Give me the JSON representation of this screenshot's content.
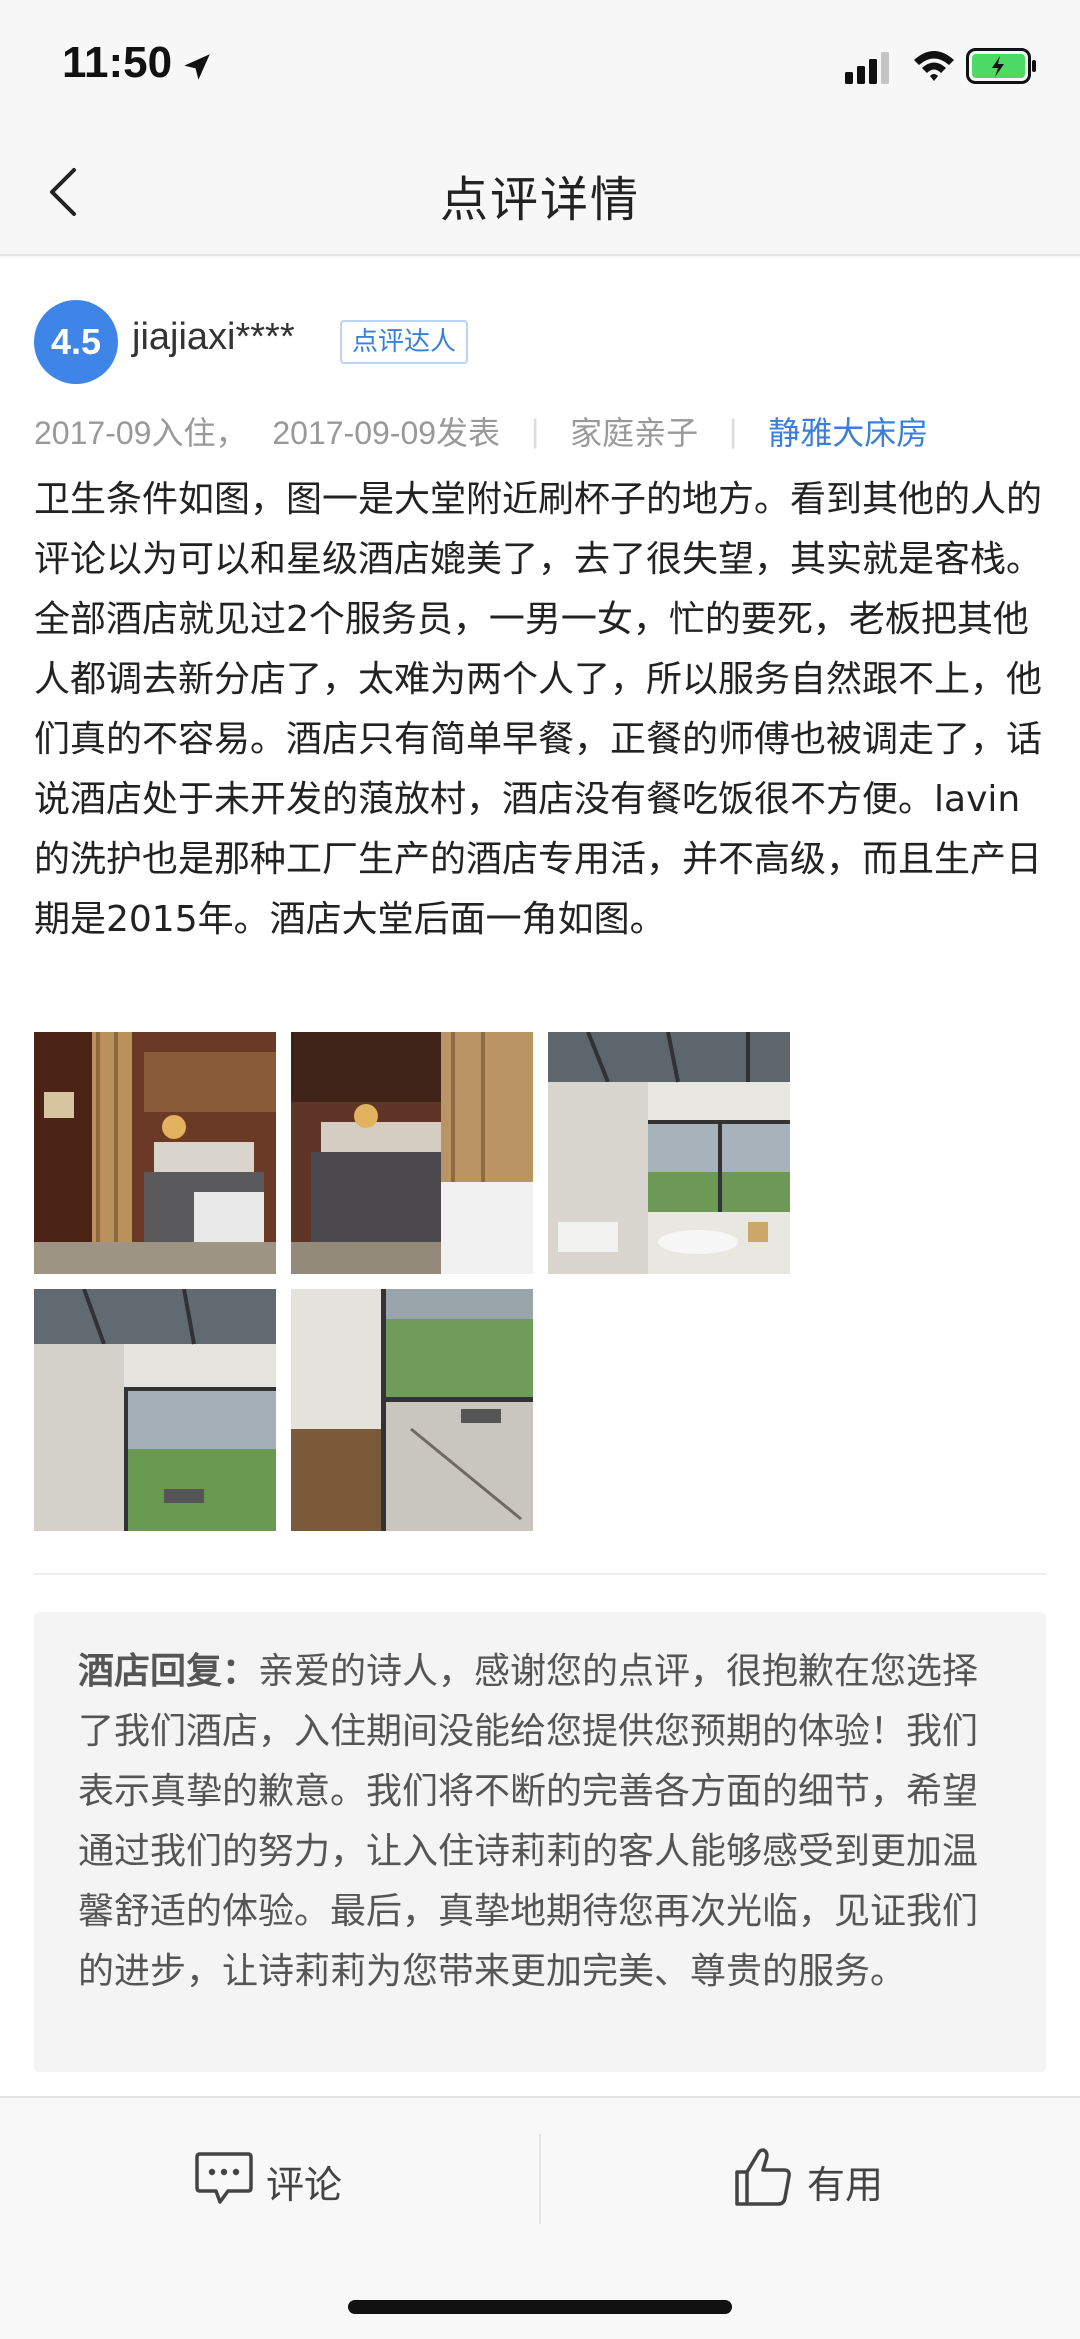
{
  "status": {
    "time": "11:50"
  },
  "nav": {
    "title": "点评详情"
  },
  "review": {
    "score": "4.5",
    "username": "jiajiaxi****",
    "badge": "点评达人",
    "checkin": "2017-09入住，",
    "published": "2017-09-09发表",
    "trip_type": "家庭亲子",
    "room_type": "静雅大床房",
    "text": "卫生条件如图，图一是大堂附近刷杯子的地方。看到其他的人的评论以为可以和星级酒店媲美了，去了很失望，其实就是客栈。全部酒店就见过2个服务员，一男一女，忙的要死，老板把其他人都调去新分店了，太难为两个人了，所以服务自然跟不上，他们真的不容易。酒店只有简单早餐，正餐的师傅也被调走了，话说酒店处于未开发的蒗放村，酒店没有餐吃饭很不方便。lavin的洗护也是那种工厂生产的酒店专用活，并不高级，而且生产日期是2015年。酒店大堂后面一角如图。",
    "photo_count": 5
  },
  "reply": {
    "label": "酒店回复：",
    "text": "亲爱的诗人，感谢您的点评，很抱歉在您选择了我们酒店，入住期间没能给您提供您预期的体验！我们表示真挚的歉意。我们将不断的完善各方面的细节，希望通过我们的努力，让入住诗莉莉的客人能够感受到更加温馨舒适的体验。最后，真挚地期待您再次光临，见证我们的进步，让诗莉莉为您带来更加完美、尊贵的服务。"
  },
  "bottom": {
    "comment_label": "评论",
    "useful_label": "有用"
  },
  "colors": {
    "accent": "#3c7fd7",
    "score_bg": "#3f85e8",
    "battery": "#4cd964"
  }
}
